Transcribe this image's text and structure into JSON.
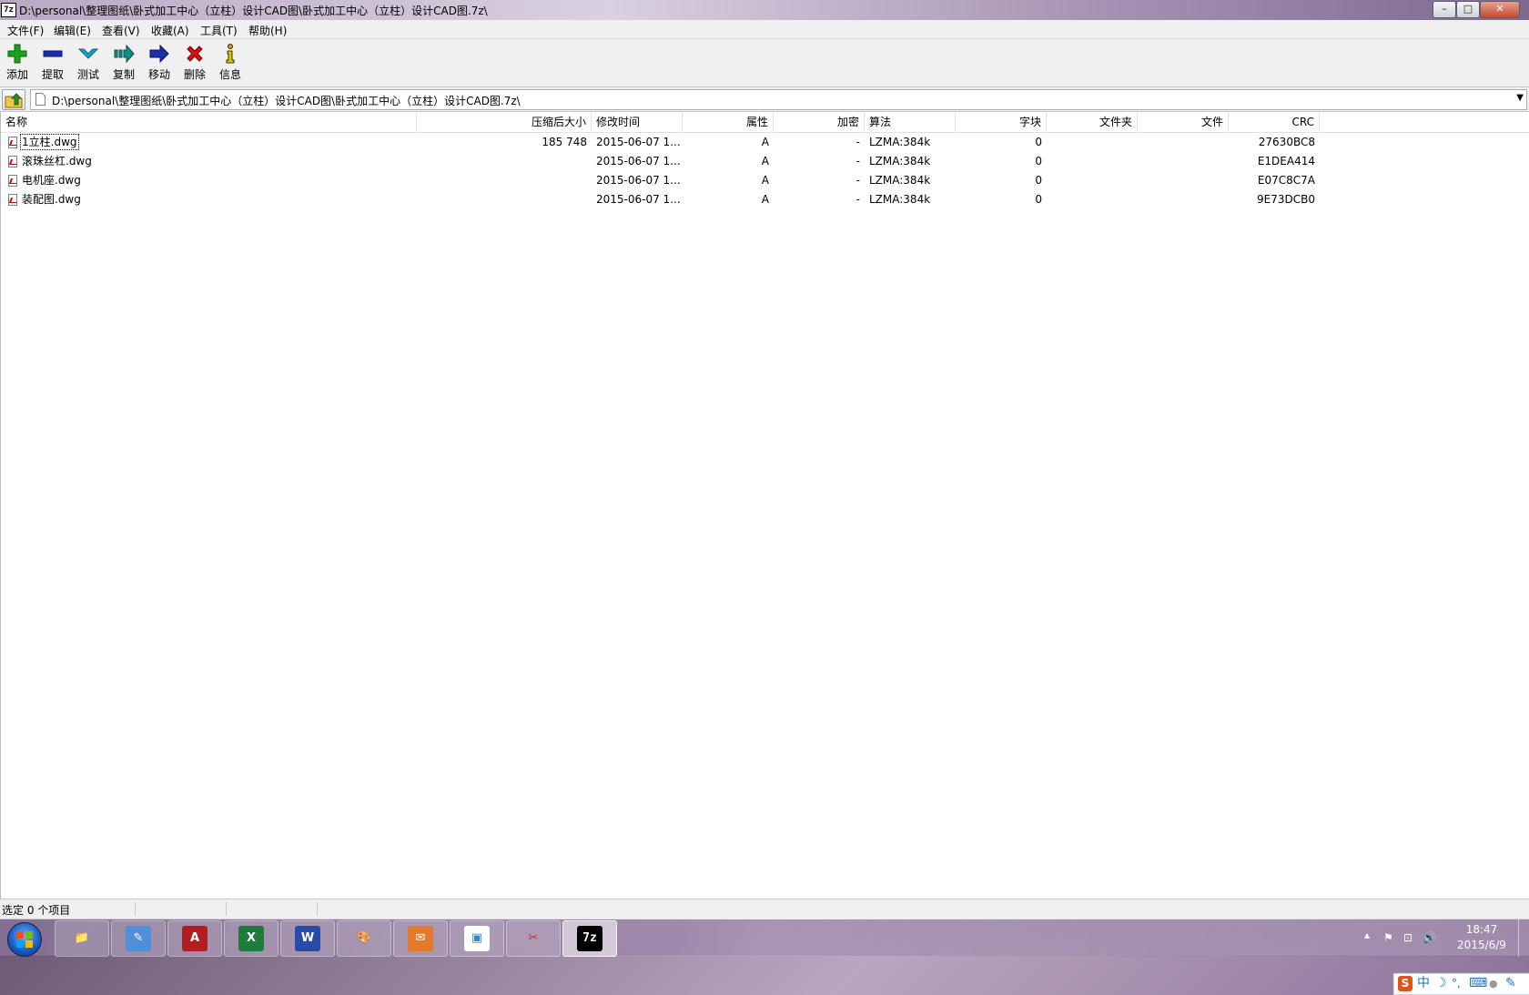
{
  "window": {
    "title": "D:\\personal\\整理图纸\\卧式加工中心（立柱）设计CAD图\\卧式加工中心（立柱）设计CAD图.7z\\",
    "app_icon": "7z",
    "minimize": "–",
    "maximize": "□",
    "close": "✕"
  },
  "menu": [
    {
      "label": "文件(F)"
    },
    {
      "label": "编辑(E)"
    },
    {
      "label": "查看(V)"
    },
    {
      "label": "收藏(A)"
    },
    {
      "label": "工具(T)"
    },
    {
      "label": "帮助(H)"
    }
  ],
  "toolbar": [
    {
      "label": "添加",
      "icon": "add-icon",
      "color": "#1aa31a"
    },
    {
      "label": "提取",
      "icon": "extract-icon",
      "color": "#1b2fa8"
    },
    {
      "label": "测试",
      "icon": "test-icon",
      "color": "#17a7c0"
    },
    {
      "label": "复制",
      "icon": "copy-icon",
      "color": "#178a8a"
    },
    {
      "label": "移动",
      "icon": "move-icon",
      "color": "#1b2fa8"
    },
    {
      "label": "删除",
      "icon": "delete-icon",
      "color": "#d81010"
    },
    {
      "label": "信息",
      "icon": "info-icon",
      "color": "#c9a400"
    }
  ],
  "address": {
    "path": "D:\\personal\\整理图纸\\卧式加工中心（立柱）设计CAD图\\卧式加工中心（立柱）设计CAD图.7z\\"
  },
  "columns": {
    "name": "名称",
    "packed_size": "压缩后大小",
    "modified": "修改时间",
    "attributes": "属性",
    "encrypted": "加密",
    "method": "算法",
    "block": "字块",
    "folders": "文件夹",
    "files": "文件",
    "crc": "CRC"
  },
  "files": [
    {
      "name": "1立柱.dwg",
      "packed_size": "185 748",
      "modified": "2015-06-07 1...",
      "attributes": "A",
      "encrypted": "-",
      "method": "LZMA:384k",
      "block": "0",
      "folders": "",
      "files": "",
      "crc": "27630BC8"
    },
    {
      "name": "滚珠丝杠.dwg",
      "packed_size": "",
      "modified": "2015-06-07 1...",
      "attributes": "A",
      "encrypted": "-",
      "method": "LZMA:384k",
      "block": "0",
      "folders": "",
      "files": "",
      "crc": "E1DEA414"
    },
    {
      "name": "电机座.dwg",
      "packed_size": "",
      "modified": "2015-06-07 1...",
      "attributes": "A",
      "encrypted": "-",
      "method": "LZMA:384k",
      "block": "0",
      "folders": "",
      "files": "",
      "crc": "E07C8C7A"
    },
    {
      "name": "装配图.dwg",
      "packed_size": "",
      "modified": "2015-06-07 1...",
      "attributes": "A",
      "encrypted": "-",
      "method": "LZMA:384k",
      "block": "0",
      "folders": "",
      "files": "",
      "crc": "9E73DCB0"
    }
  ],
  "ime": {
    "logo": "S",
    "mode": "中",
    "moon": "☽",
    "punct": "°,",
    "keyboard": "⌨",
    "user": "●",
    "tool": "✎"
  },
  "status": {
    "text": "选定 0 个项目"
  },
  "taskbar": {
    "apps": [
      {
        "name": "explorer",
        "glyph": "📁",
        "color": "#e8c15a"
      },
      {
        "name": "draw",
        "glyph": "✎",
        "color": "#4f8ed8"
      },
      {
        "name": "autocad",
        "glyph": "A",
        "color": "#b01e24"
      },
      {
        "name": "excel",
        "glyph": "X",
        "color": "#1f7a3e"
      },
      {
        "name": "archive",
        "glyph": "W",
        "color": "#2a4aa8"
      },
      {
        "name": "paint",
        "glyph": "🎨",
        "color": "#7fb0e0"
      },
      {
        "name": "mail",
        "glyph": "✉",
        "color": "#e27a2b"
      },
      {
        "name": "window",
        "glyph": "▣",
        "color": "#2c84d8"
      },
      {
        "name": "snipping",
        "glyph": "✂",
        "color": "#c03030"
      },
      {
        "name": "7zip",
        "glyph": "7z",
        "color": "#000000"
      }
    ],
    "tray": {
      "up_arrow": "▲",
      "flag": "⚑",
      "network": "⊡",
      "volume": "🔊"
    },
    "time": "18:47",
    "date": "2015/6/9"
  }
}
